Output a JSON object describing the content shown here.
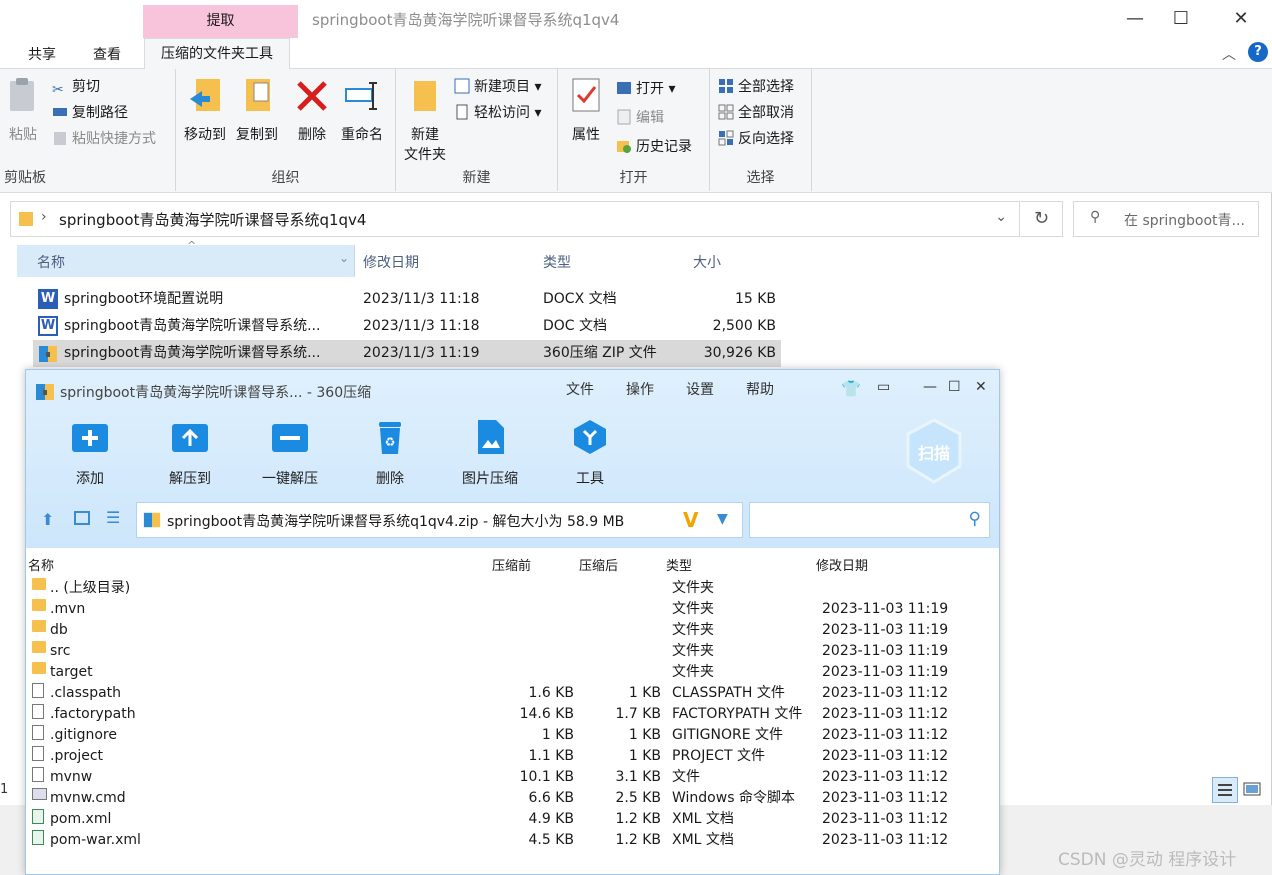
{
  "explorer": {
    "context_tab": "提取",
    "window_title": "springboot青岛黄海学院听课督导系统q1qv4",
    "tabs": [
      "共享",
      "查看",
      "压缩的文件夹工具"
    ],
    "ribbon": {
      "clipboard": {
        "group": "剪贴板",
        "paste": "粘贴",
        "cut": "剪切",
        "copy_path": "复制路径",
        "paste_shortcut": "粘贴快捷方式"
      },
      "organize": {
        "group": "组织",
        "move_to": "移动到",
        "copy_to": "复制到",
        "delete": "删除",
        "rename": "重命名"
      },
      "new": {
        "group": "新建",
        "new_folder_line1": "新建",
        "new_folder_line2": "文件夹",
        "new_item": "新建项目",
        "easy_access": "轻松访问"
      },
      "open": {
        "group": "打开",
        "properties": "属性",
        "open": "打开",
        "edit": "编辑",
        "history": "历史记录"
      },
      "select": {
        "group": "选择",
        "select_all": "全部选择",
        "select_none": "全部取消",
        "invert": "反向选择"
      }
    },
    "address": "springboot青岛黄海学院听课督导系统q1qv4",
    "search_placeholder": "在 springboot青...",
    "columns": {
      "name": "名称",
      "modified": "修改日期",
      "type": "类型",
      "size": "大小"
    },
    "files": [
      {
        "name": "springboot环境配置说明",
        "modified": "2023/11/3 11:18",
        "type": "DOCX 文档",
        "size": "15 KB"
      },
      {
        "name": "springboot青岛黄海学院听课督导系统...",
        "modified": "2023/11/3 11:18",
        "type": "DOC 文档",
        "size": "2,500 KB"
      },
      {
        "name": "springboot青岛黄海学院听课督导系统...",
        "modified": "2023/11/3 11:19",
        "type": "360压缩 ZIP 文件",
        "size": "30,926 KB"
      }
    ],
    "status_left": "1"
  },
  "zip": {
    "title": "springboot青岛黄海学院听课督导系... - 360压缩",
    "menu": [
      "文件",
      "操作",
      "设置",
      "帮助"
    ],
    "tools": [
      "添加",
      "解压到",
      "一键解压",
      "删除",
      "图片压缩",
      "工具"
    ],
    "scan": "扫描",
    "path": "springboot青岛黄海学院听课督导系统q1qv4.zip - 解包大小为 58.9 MB",
    "columns": {
      "name": "名称",
      "before": "压缩前",
      "after": "压缩后",
      "type": "类型",
      "modified": "修改日期"
    },
    "rows": [
      {
        "name": ".. (上级目录)",
        "before": "",
        "after": "",
        "type": "文件夹",
        "modified": "",
        "kind": "folder"
      },
      {
        "name": ".mvn",
        "before": "",
        "after": "",
        "type": "文件夹",
        "modified": "2023-11-03 11:19",
        "kind": "folder"
      },
      {
        "name": "db",
        "before": "",
        "after": "",
        "type": "文件夹",
        "modified": "2023-11-03 11:19",
        "kind": "folder"
      },
      {
        "name": "src",
        "before": "",
        "after": "",
        "type": "文件夹",
        "modified": "2023-11-03 11:19",
        "kind": "folder"
      },
      {
        "name": "target",
        "before": "",
        "after": "",
        "type": "文件夹",
        "modified": "2023-11-03 11:19",
        "kind": "folder"
      },
      {
        "name": ".classpath",
        "before": "1.6 KB",
        "after": "1 KB",
        "type": "CLASSPATH 文件",
        "modified": "2023-11-03 11:12",
        "kind": "file"
      },
      {
        "name": ".factorypath",
        "before": "14.6 KB",
        "after": "1.7 KB",
        "type": "FACTORYPATH 文件",
        "modified": "2023-11-03 11:12",
        "kind": "file"
      },
      {
        "name": ".gitignore",
        "before": "1 KB",
        "after": "1 KB",
        "type": "GITIGNORE 文件",
        "modified": "2023-11-03 11:12",
        "kind": "file"
      },
      {
        "name": ".project",
        "before": "1.1 KB",
        "after": "1 KB",
        "type": "PROJECT 文件",
        "modified": "2023-11-03 11:12",
        "kind": "file"
      },
      {
        "name": "mvnw",
        "before": "10.1 KB",
        "after": "3.1 KB",
        "type": "文件",
        "modified": "2023-11-03 11:12",
        "kind": "file"
      },
      {
        "name": "mvnw.cmd",
        "before": "6.6 KB",
        "after": "2.5 KB",
        "type": "Windows 命令脚本",
        "modified": "2023-11-03 11:12",
        "kind": "cmd"
      },
      {
        "name": "pom.xml",
        "before": "4.9 KB",
        "after": "1.2 KB",
        "type": "XML 文档",
        "modified": "2023-11-03 11:12",
        "kind": "xml"
      },
      {
        "name": "pom-war.xml",
        "before": "4.5 KB",
        "after": "1.2 KB",
        "type": "XML 文档",
        "modified": "2023-11-03 11:12",
        "kind": "xml"
      }
    ]
  },
  "watermark": "CSDN @灵动 程序设计",
  "colors": {
    "accent": "#1a7fd4",
    "selection": "#d9d9d9",
    "context_tab": "#f8c4dc",
    "header_bg": "#d9ebf9"
  }
}
